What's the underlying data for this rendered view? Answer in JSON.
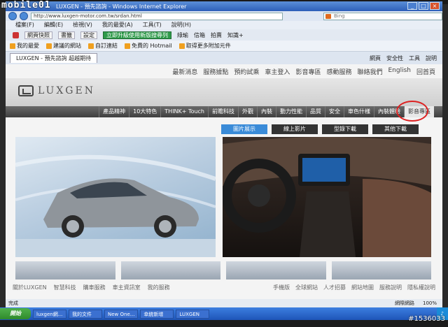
{
  "window": {
    "title": "LUXGEN - 預先諮詢 - Windows Internet Explorer",
    "url": "http://www.luxgen-motor.com.tw/srdan.html",
    "search_placeholder": "Bing"
  },
  "menu": [
    "檔案(F)",
    "編輯(E)",
    "檢視(V)",
    "我的最愛(A)",
    "工具(T)",
    "說明(H)"
  ],
  "toolbar": {
    "snapshot_label": "網頁快照",
    "bookmark_label": "書籤",
    "settings_label": "設定",
    "upgrade_label": "立即升級使用新版搜尋列",
    "items": [
      "綠瑜",
      "信箱",
      "拍賣",
      "知識+"
    ]
  },
  "favorites": {
    "label": "我的最愛",
    "items": [
      "建議的網站",
      "自訂連結",
      "免費的 Hotmail",
      "取得更多附加元件"
    ]
  },
  "tab": {
    "label": "LUXGEN - 預先諮詢 超越期待",
    "tools": [
      "網頁",
      "安全性",
      "工具",
      "說明"
    ]
  },
  "site": {
    "top_nav": [
      "最新消息",
      "服務據點",
      "預約試乘",
      "車主登入",
      "影音專區",
      "感動服務",
      "聯絡我們",
      "English",
      "回首頁"
    ],
    "brand": "LUXGEN",
    "main_nav": [
      "產品精神",
      "10大特色",
      "THINK+ Touch",
      "前瞻科技",
      "外觀",
      "內裝",
      "動力性能",
      "品質",
      "安全",
      "車色什樣",
      "內裝體驗",
      "影音專區"
    ],
    "sub_tabs": [
      "圖片展示",
      "線上影片",
      "型錄下載",
      "其他下載"
    ],
    "footer_left": [
      "關於LUXGEN",
      "智慧科技",
      "購車服務",
      "車主資訊室",
      "我的服務"
    ],
    "footer_right": [
      "手機版",
      "全球網站",
      "人才招募",
      "網站地圖",
      "服務說明",
      "隱私權說明"
    ]
  },
  "status": {
    "text": "完成",
    "zone": "網際網路",
    "zoom": "100%"
  },
  "taskbar": {
    "start_label": "開始",
    "tasks": [
      "luxgen網...",
      "我的文件",
      "New One...",
      "幸統新增",
      "LUXGEN"
    ]
  },
  "watermarks": {
    "top_left": "mobile01",
    "bottom_right": "#1536033"
  },
  "colors": {
    "accent_tab": "#3a8bd8",
    "upgrade_green": "#2e9a4a",
    "highlight_circle": "#dd2222"
  }
}
